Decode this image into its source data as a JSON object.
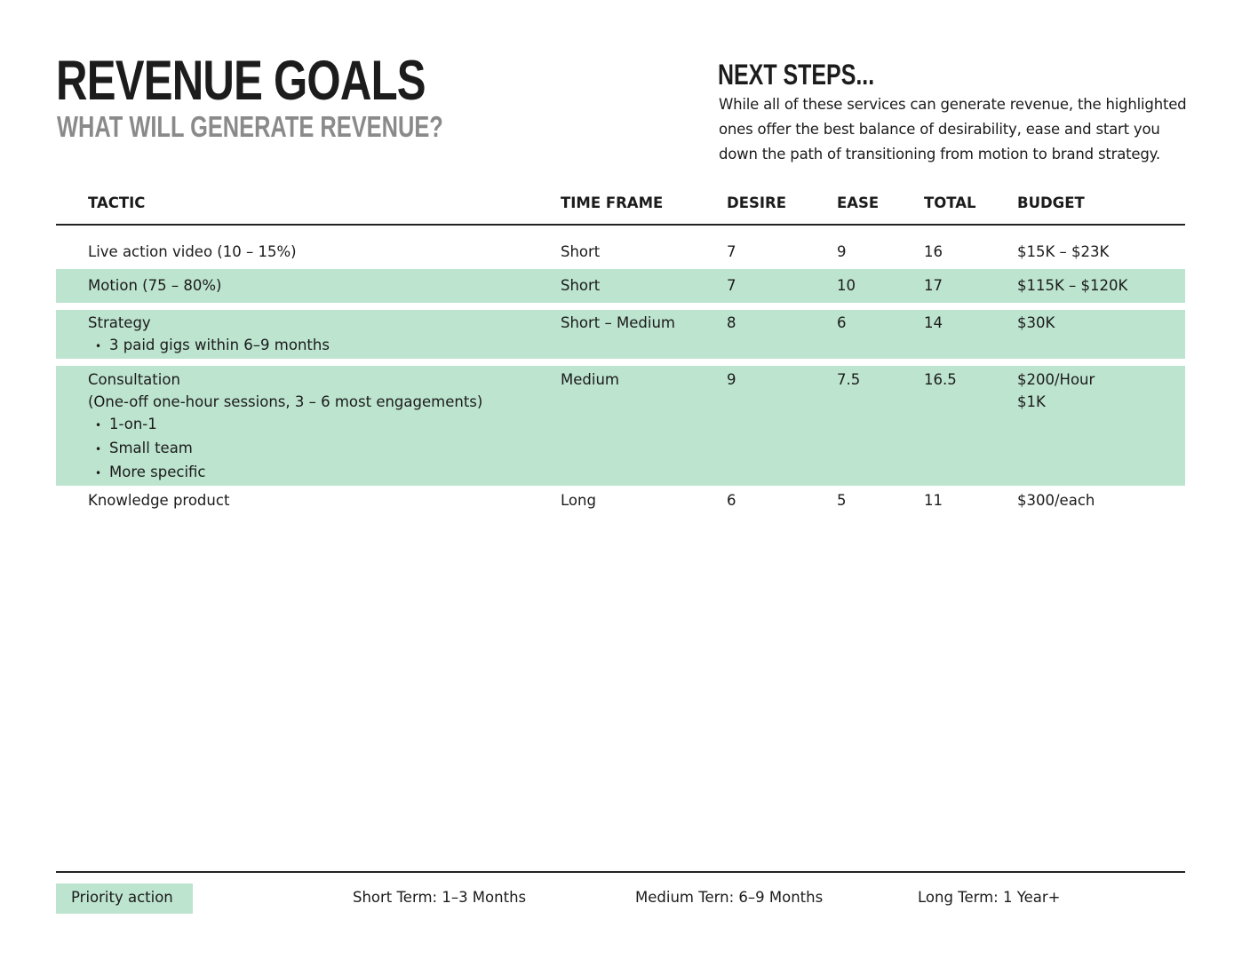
{
  "header": {
    "title": "REVENUE GOALS",
    "subtitle": "WHAT WILL GENERATE REVENUE?"
  },
  "next_steps": {
    "heading": "NEXT STEPS...",
    "body": "While all of these services can generate revenue, the highlighted ones offer the best balance of desirability, ease and start you down the path of transitioning from motion to brand strategy."
  },
  "table": {
    "headers": {
      "tactic": "TACTIC",
      "time_frame": "TIME FRAME",
      "desire": "DESIRE",
      "ease": "EASE",
      "total": "TOTAL",
      "budget": "BUDGET"
    },
    "rows": [
      {
        "tactic": "Live action video (10 – 15%)",
        "details": [],
        "bullets": [],
        "time_frame": "Short",
        "desire": "7",
        "ease": "9",
        "total": "16",
        "budget": [
          "$15K – $23K"
        ],
        "highlighted": false
      },
      {
        "tactic": "Motion (75 – 80%)",
        "details": [],
        "bullets": [],
        "time_frame": "Short",
        "desire": "7",
        "ease": "10",
        "total": "17",
        "budget": [
          "$115K – $120K"
        ],
        "highlighted": true
      },
      {
        "tactic": "Strategy",
        "details": [],
        "bullets": [
          "3 paid gigs within 6–9 months"
        ],
        "time_frame": "Short – Medium",
        "desire": "8",
        "ease": "6",
        "total": "14",
        "budget": [
          "$30K"
        ],
        "highlighted": true
      },
      {
        "tactic": "Consultation",
        "details": [
          "(One-off one-hour sessions, 3 – 6 most engagements)"
        ],
        "bullets": [
          "1-on-1",
          "Small team",
          "More specific"
        ],
        "time_frame": "Medium",
        "desire": "9",
        "ease": "7.5",
        "total": "16.5",
        "budget": [
          "$200/Hour",
          "$1K"
        ],
        "highlighted": true
      },
      {
        "tactic": "Knowledge product",
        "details": [],
        "bullets": [],
        "time_frame": "Long",
        "desire": "6",
        "ease": "5",
        "total": "11",
        "budget": [
          "$300/each"
        ],
        "highlighted": false
      }
    ]
  },
  "legend": {
    "priority_label": "Priority action",
    "priority_color": "#bde4cf",
    "short_term": "Short Term: 1–3 Months",
    "medium_term": "Medium Tern: 6–9 Months",
    "long_term": "Long Term: 1 Year+"
  }
}
